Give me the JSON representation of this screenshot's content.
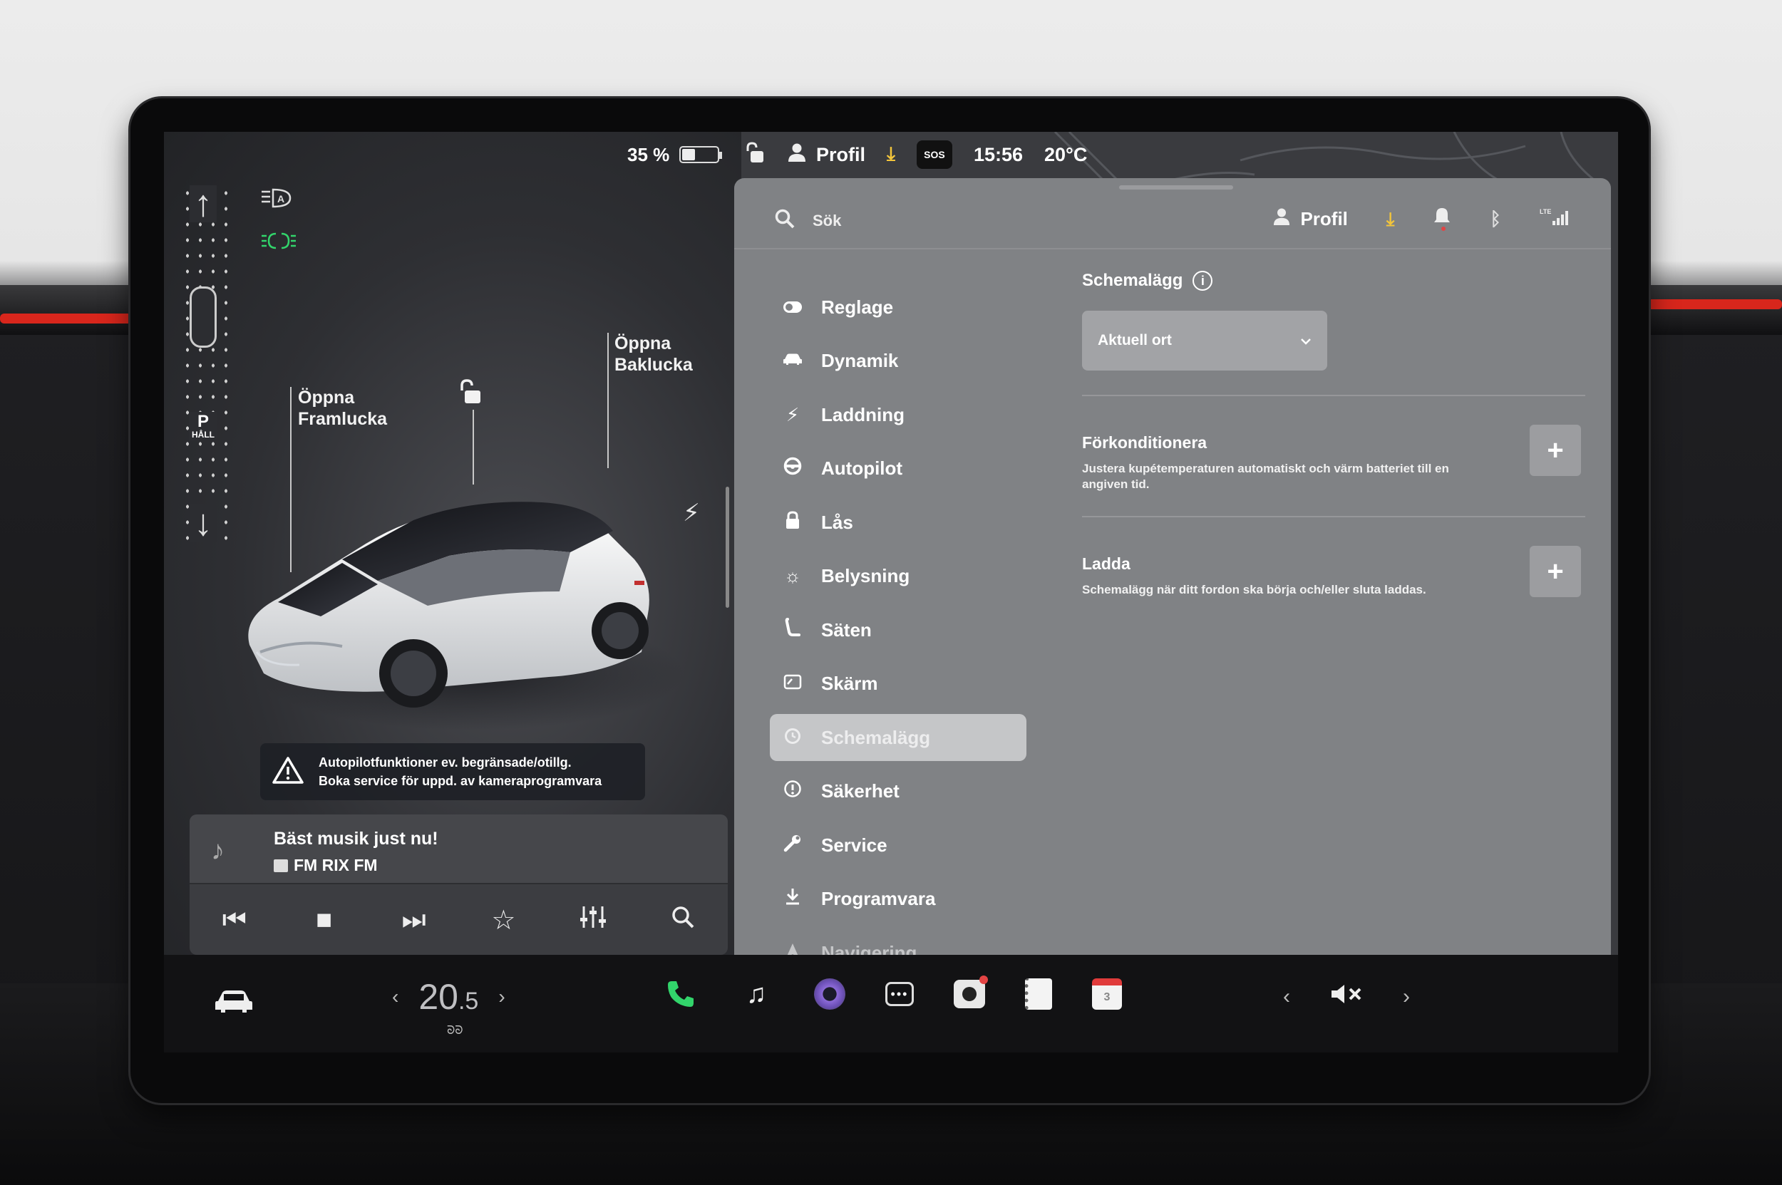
{
  "status": {
    "battery_percent": "35 %",
    "profile": "Profil",
    "sos": "SOS",
    "time": "15:56",
    "temperature": "20°C"
  },
  "drive": {
    "gear": "P",
    "gear_sub": "HÅLL"
  },
  "vehicle": {
    "frunk_label_1": "Öppna",
    "frunk_label_2": "Framlucka",
    "trunk_label_1": "Öppna",
    "trunk_label_2": "Baklucka",
    "body_color": "#eef0f2"
  },
  "warning": {
    "line1": "Autopilotfunktioner ev. begränsade/otillg.",
    "line2": "Boka service för uppd. av kameraprogramvara"
  },
  "media": {
    "song": "Bäst musik just nu!",
    "station": "FM RIX FM"
  },
  "settings": {
    "search_placeholder": "Sök",
    "profile": "Profil",
    "nav": [
      {
        "label": "Reglage",
        "icon": "toggle-icon"
      },
      {
        "label": "Dynamik",
        "icon": "car-icon"
      },
      {
        "label": "Laddning",
        "icon": "bolt-icon"
      },
      {
        "label": "Autopilot",
        "icon": "steering-wheel-icon"
      },
      {
        "label": "Lås",
        "icon": "lock-icon"
      },
      {
        "label": "Belysning",
        "icon": "sun-icon"
      },
      {
        "label": "Säten",
        "icon": "seat-icon"
      },
      {
        "label": "Skärm",
        "icon": "display-icon"
      },
      {
        "label": "Schemalägg",
        "icon": "clock-icon"
      },
      {
        "label": "Säkerhet",
        "icon": "alert-circle-icon"
      },
      {
        "label": "Service",
        "icon": "wrench-icon"
      },
      {
        "label": "Programvara",
        "icon": "download-icon"
      },
      {
        "label": "Navigering",
        "icon": "navigation-icon"
      }
    ],
    "active_index": 8,
    "section_title": "Schemalägg",
    "location_value": "Aktuell ort",
    "options": [
      {
        "title": "Förkonditionera",
        "desc": "Justera kupétemperaturen automatiskt och värm batteriet till en angiven tid."
      },
      {
        "title": "Ladda",
        "desc": "Schemalägg när ditt fordon ska börja och/eller sluta laddas."
      }
    ]
  },
  "taskbar": {
    "temp_whole": "20",
    "temp_decimal": ".5",
    "calendar_day": "3"
  },
  "colors": {
    "accent_green": "#32d46b",
    "download_yellow": "#f3c53b",
    "alert_red": "#e34444"
  }
}
